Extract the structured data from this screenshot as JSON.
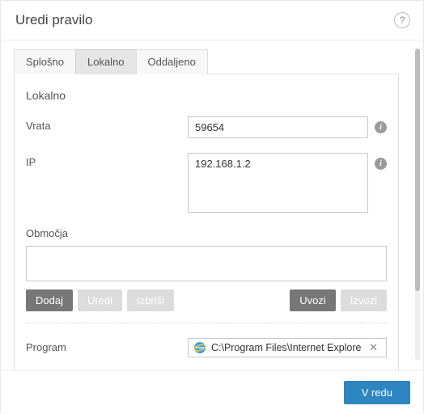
{
  "header": {
    "title": "Uredi pravilo"
  },
  "tabs": {
    "general": "Splošno",
    "local": "Lokalno",
    "remote": "Oddaljeno"
  },
  "local": {
    "section_title": "Lokalno",
    "port_label": "Vrata",
    "port_value": "59654",
    "ip_label": "IP",
    "ip_value": "192.168.1.2",
    "zones_label": "Območja",
    "add_btn": "Dodaj",
    "edit_btn": "Uredi",
    "delete_btn": "Izbriši",
    "import_btn": "Uvozi",
    "export_btn": "Izvozi",
    "program_label": "Program",
    "program_value": "C:\\Program Files\\Internet Explorer\\"
  },
  "footer": {
    "ok_btn": "V redu"
  }
}
